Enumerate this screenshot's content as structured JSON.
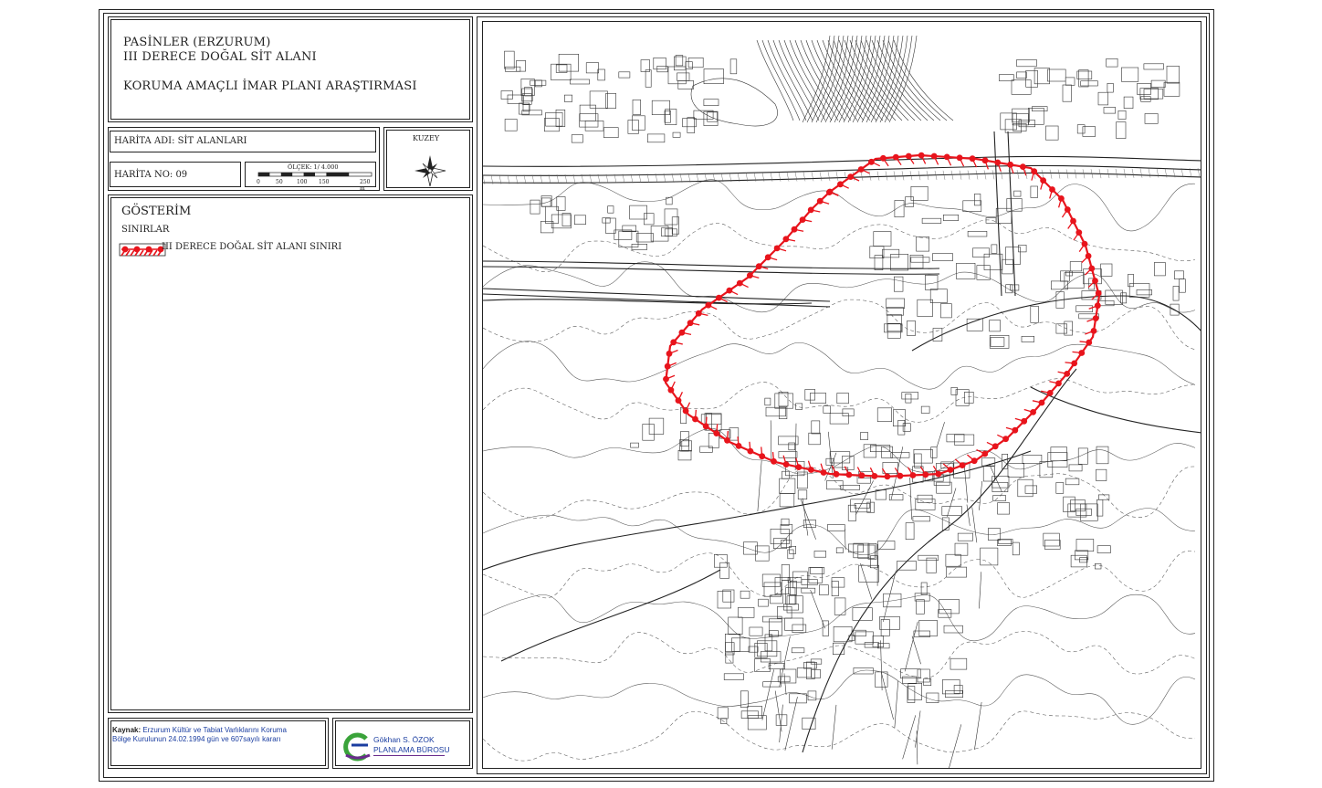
{
  "header": {
    "line1": "PASİNLER (ERZURUM)",
    "line2": "III DERECE DOĞAL SİT ALANI",
    "line3": "KORUMA AMAÇLI İMAR PLANI ARAŞTIRMASI"
  },
  "map_info": {
    "name_label": "HARİTA ADI: SİT ALANLARI",
    "number_label": "HARİTA NO: 09",
    "scale_label": "ÖLÇEK: 1/ 4.000",
    "scale_ticks": [
      "0",
      "50",
      "100",
      "150",
      "250 m"
    ]
  },
  "north": {
    "label": "KUZEY",
    "icon": "compass-rose-icon"
  },
  "legend": {
    "title": "GÖSTERİM",
    "section": "SINIRLAR",
    "items": [
      {
        "label": "III DERECE DOĞAL SİT ALANI SINIRI",
        "icon": "site-boundary-symbol",
        "color": "#e8141c"
      }
    ]
  },
  "footer": {
    "source_key": "Kaynak:",
    "source_line1": " Erzurum Kültür ve Tabiat Varlıklarını Koruma",
    "source_line2": "Bölge Kurulunun  24.02.1994  gün ve 607sayılı kararı",
    "firm_line1": "Gökhan S. ÖZOK",
    "firm_line2": "PLANLAMA BÜROSU",
    "firm_logo": "firm-logo-icon"
  },
  "colors": {
    "boundary": "#e8141c",
    "line": "#222222",
    "firm_text": "#1a3da0",
    "logo_green": "#3aa33a",
    "logo_purple": "#6a2c8c"
  }
}
